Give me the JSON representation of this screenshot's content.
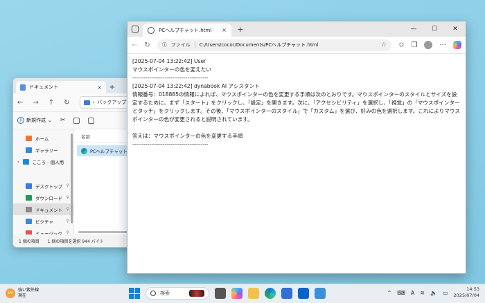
{
  "explorer": {
    "tab_label": "ドキュメント",
    "breadcrumb": "バックアップ",
    "new_button": "新規作成",
    "sidebar": [
      {
        "label": "ホーム",
        "color": "#e07a3a",
        "pinned": false,
        "chevron": false
      },
      {
        "label": "ギャラリー",
        "color": "#3a86d6",
        "pinned": false,
        "chevron": false
      },
      {
        "label": "こころ - 個人用",
        "color": "#1e88e5",
        "pinned": false,
        "chevron": true
      },
      {
        "label": "デスクトップ",
        "color": "#3a7bd5",
        "pinned": true,
        "chevron": false
      },
      {
        "label": "ダウンロード",
        "color": "#1f9d55",
        "pinned": true,
        "chevron": false
      },
      {
        "label": "ドキュメント",
        "color": "#8a8a8a",
        "pinned": true,
        "chevron": false,
        "selected": true
      },
      {
        "label": "ピクチャ",
        "color": "#3a86d6",
        "pinned": true,
        "chevron": false
      },
      {
        "label": "ミュージック",
        "color": "#e0524f",
        "pinned": true,
        "chevron": false
      }
    ],
    "column_header": "名前",
    "file_name": "PCヘルプチャット",
    "status_count": "1 個の項目",
    "status_selected": "1 個の項目を選択  944 バイト"
  },
  "edge": {
    "tab_title": "PCヘルプチャット.html",
    "address_label": "ファイル",
    "address_url": "C:/Users/cocor/Documents/PCヘルプチャット.html",
    "content": {
      "user_header": "[2025-07-04 13:22:42] User",
      "user_message": "マウスポインターの色を変えたい",
      "divider1": "----------------------------------------",
      "ai_header": "[2025-07-04 13:22:42] dynabook AI アシスタント",
      "ai_message": "情報番号：018885の情報によれば、マウスポインターの色を変更する手順は次のとおりです。マウスポインターのスタイルとサイズを設定するために、まず「スタート」をクリックし、「設定」を開きます。次に、「アクセシビリティ」を選択し、「視覚」の「マウスポインターとタッチ」をクリックします。その後、「マウスポインターのスタイル」で「カスタム」を選び、好みの色を選択します。これによりマウスポインターの色が変更されると説明されています。",
      "answer": "答えは：マウスポインターの色を変更する手順",
      "divider2": "----------------------------------------"
    }
  },
  "taskbar": {
    "weather_title": "強い紫外線",
    "weather_sub": "現在",
    "uv_badge": "UV",
    "search_placeholder": "検索",
    "ime": "A",
    "time": "14:53",
    "date": "2025/07/04"
  }
}
